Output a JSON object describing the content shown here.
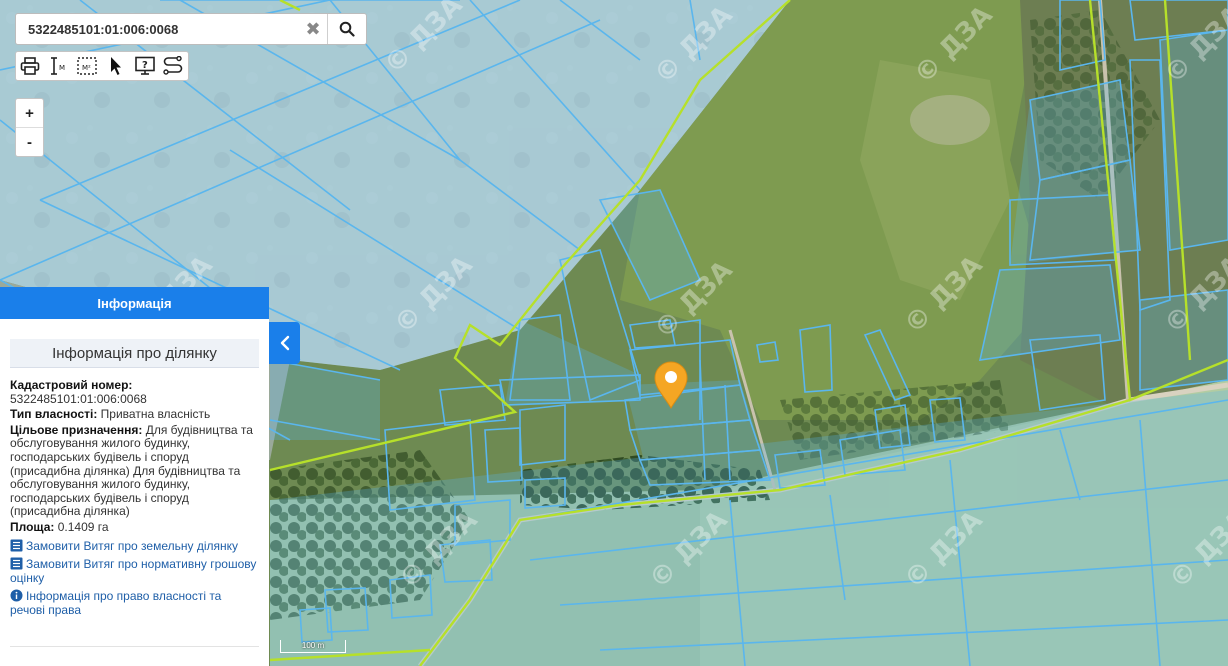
{
  "search": {
    "value": "5322485101:01:006:0068",
    "clear_glyph": "✖",
    "search_icon": "search-icon"
  },
  "toolbar": {
    "tools": [
      {
        "name": "print-icon"
      },
      {
        "name": "measure-distance-icon",
        "glyph": "M"
      },
      {
        "name": "measure-area-icon",
        "glyph": "M²"
      },
      {
        "name": "pointer-cursor-icon"
      },
      {
        "name": "help-screen-icon",
        "glyph": "?"
      },
      {
        "name": "route-icon"
      }
    ]
  },
  "zoom": {
    "in_label": "+",
    "out_label": "-"
  },
  "map": {
    "watermark": "© ДЗА",
    "scale_label": "100 m",
    "marker_color": "#f5a623",
    "parcel_color": "#5ab6ee",
    "boundary_color": "#b6e02a"
  },
  "info_panel": {
    "header": "Інформація",
    "subtitle": "Інформація про ділянку",
    "cadastral_label": "Кадастровий номер:",
    "cadastral_value": "5322485101:01:006:0068",
    "ownership_label": "Тип власності:",
    "ownership_value": "Приватна власність",
    "purpose_label": "Цільове призначення:",
    "purpose_value": "Для будівництва та обслуговування жилого будинку, господарських будівель і споруд (присадибна ділянка) Для будівництва та обслуговування жилого будинку, господарських будівель і споруд (присадибна ділянка)",
    "area_label": "Площа:",
    "area_value": "0.1409 га",
    "links": [
      {
        "icon": "document-list-icon",
        "text": "Замовити Витяг про земельну ділянку"
      },
      {
        "icon": "document-list-icon",
        "text": "Замовити Витяг про нормативну грошову оцінку"
      },
      {
        "icon": "info-circle-icon",
        "text": "Інформація про право власності та речові права"
      }
    ],
    "collapse_icon": "chevron-left-icon"
  },
  "colors": {
    "accent": "#1a7fea",
    "link": "#1f5fa8"
  }
}
